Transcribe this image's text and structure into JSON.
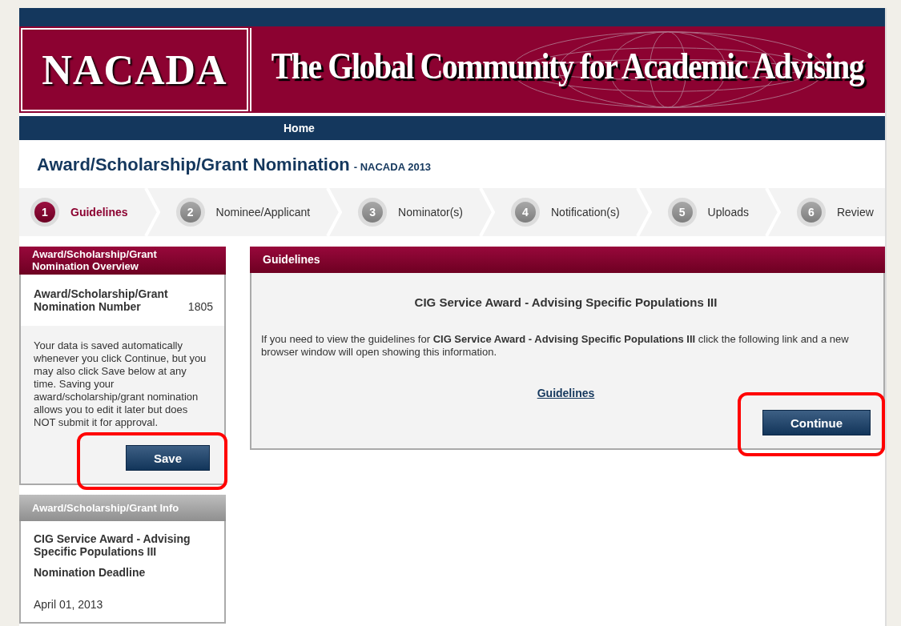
{
  "banner": {
    "logo": "NACADA",
    "tagline": "The Global Community for Academic Advising"
  },
  "nav": {
    "items": [
      {
        "label": "Home"
      }
    ]
  },
  "page_title": {
    "title": "Award/Scholarship/Grant Nomination",
    "subtitle": "- NACADA 2013"
  },
  "steps": [
    {
      "number": "1",
      "label": "Guidelines",
      "selected": true
    },
    {
      "number": "2",
      "label": "Nominee/Applicant",
      "selected": false
    },
    {
      "number": "3",
      "label": "Nominator(s)",
      "selected": false
    },
    {
      "number": "4",
      "label": "Notification(s)",
      "selected": false
    },
    {
      "number": "5",
      "label": "Uploads",
      "selected": false
    },
    {
      "number": "6",
      "label": "Review",
      "selected": false
    }
  ],
  "overview": {
    "title": "Award/Scholarship/Grant Nomination Overview",
    "number_label": "Award/Scholarship/Grant Nomination Number",
    "number_value": "1805",
    "note": "Your data is saved automatically whenever you click Continue, but you may also click Save below at any time. Saving your award/scholarship/grant nomination allows you to edit it later but does NOT submit it for approval.",
    "save_button": {
      "label": "Save",
      "highlighted": true
    }
  },
  "info": {
    "title": "Award/Scholarship/Grant Info",
    "award_name": "CIG Service Award - Advising Specific Populations III",
    "deadline_label": "Nomination Deadline",
    "deadline": "April 01, 2013"
  },
  "guidelines": {
    "title": "Guidelines",
    "award_heading": "CIG Service Award - Advising Specific Populations III",
    "text": "If you need to view the guidelines for **CIG Service Award - Advising Specific Populations III** click the following link and a new browser window will open showing this information.",
    "link": "Guidelines",
    "continue_button": {
      "label": "Continue",
      "highlighted": true
    }
  }
}
